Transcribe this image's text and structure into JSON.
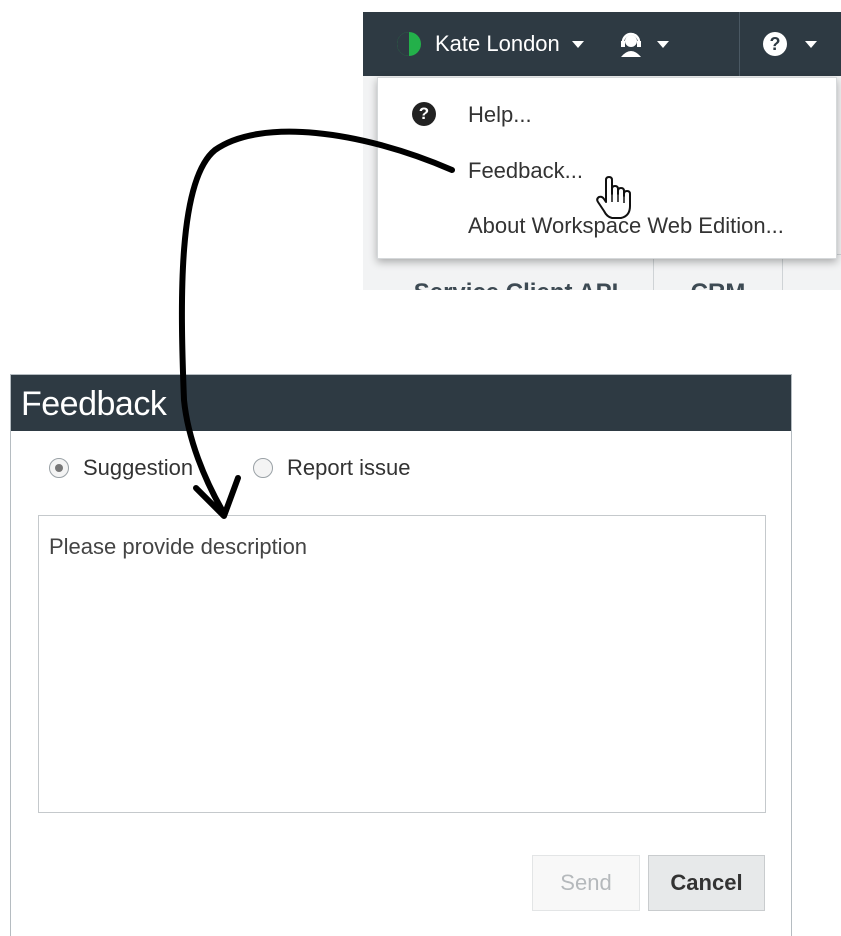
{
  "topbar": {
    "user_name": "Kate London",
    "status_color": "#23b04a",
    "agent_icon": "headset-agent-icon",
    "help_icon": "help-question-icon"
  },
  "background_tabs": [
    "Service Client API",
    "CRM"
  ],
  "help_menu": {
    "items": [
      {
        "label": "Help...",
        "icon": "help-question-icon"
      },
      {
        "label": "Feedback...",
        "icon": ""
      },
      {
        "label": "About Workspace Web Edition...",
        "icon": ""
      }
    ],
    "hovered": "Feedback..."
  },
  "dialog": {
    "title": "Feedback",
    "radio_options": [
      {
        "label": "Suggestion",
        "checked": true
      },
      {
        "label": "Report issue",
        "checked": false
      }
    ],
    "description_placeholder": "Please provide description",
    "description_value": "",
    "send_label": "Send",
    "cancel_label": "Cancel"
  },
  "colors": {
    "header_bg": "#2e3a43",
    "accent_green": "#23b04a"
  }
}
